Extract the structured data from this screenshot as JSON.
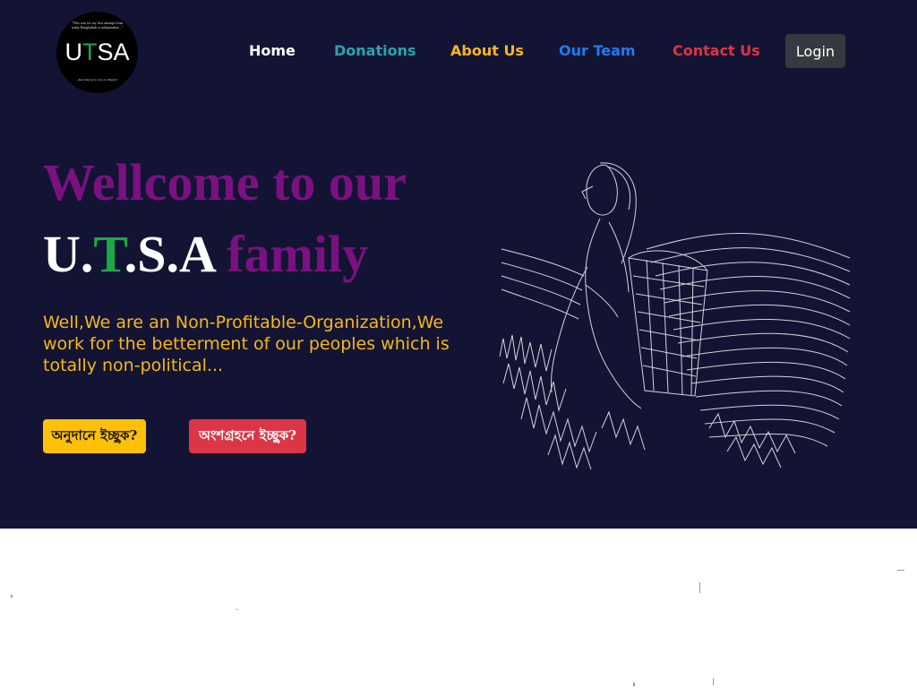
{
  "logo": {
    "top_text": "\"This was for my first attempt from today Bangladesh is independent...\"",
    "word_a": "U",
    "word_b": "T",
    "word_c": "SA",
    "bottom_text": "...Real history is own, be Bangla\""
  },
  "nav": {
    "home": "Home",
    "donations": "Donations",
    "about": "About Us",
    "team": "Our Team",
    "contact": "Contact Us",
    "login": "Login"
  },
  "hero": {
    "welcome": "Wellcome to our",
    "utsa_u": "U.",
    "utsa_t": "T",
    "utsa_rest": ".S.A",
    "family": "family",
    "tagline": "Well,We are an Non-Profitable-Organization,We work for the betterment of our peoples which is totally non-political...",
    "cta_donate": "অনুদানে ইচ্ছুক?",
    "cta_join": "অংশগ্রহনে ইচ্ছুক?"
  },
  "illustration": {
    "icon": "tea-picker-woman-illustration"
  },
  "colors": {
    "hero_bg": "#131433",
    "purple": "#7a1181",
    "green": "#1ea84a",
    "yellow": "#f6b71d",
    "teal": "#2aa3b4",
    "blue": "#1f7cf3",
    "red": "#dc3545",
    "login_bg": "#343a40"
  }
}
